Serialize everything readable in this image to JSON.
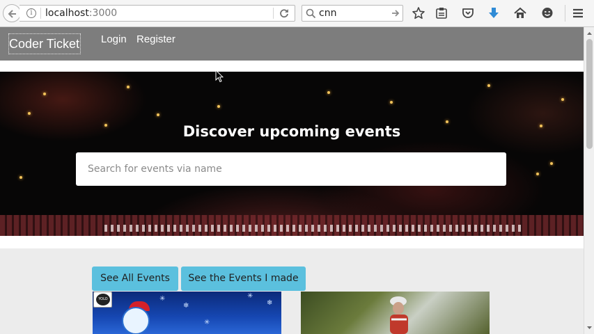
{
  "browser": {
    "url_host": "localhost",
    "url_port": ":3000",
    "search_query": "cnn",
    "icons": [
      "back-arrow-icon",
      "info-icon",
      "reload-icon",
      "search-icon",
      "search-go-icon",
      "bookmark-star-icon",
      "reading-list-icon",
      "pocket-icon",
      "download-icon",
      "home-icon",
      "chat-icon",
      "menu-icon"
    ]
  },
  "navbar": {
    "brand": "Coder Ticket",
    "links": [
      "Login",
      "Register"
    ]
  },
  "hero": {
    "title": "Discover upcoming events",
    "search_placeholder": "Search for events via name"
  },
  "actions": {
    "see_all": "See All Events",
    "see_mine": "See the Events I made"
  },
  "cards": [
    {
      "badge": "YOLO"
    },
    {}
  ],
  "colors": {
    "navbar_bg": "#7d7d7d",
    "button_bg": "#5bc0de",
    "page_bg": "#ececec",
    "download_blue": "#2f8bd6"
  }
}
